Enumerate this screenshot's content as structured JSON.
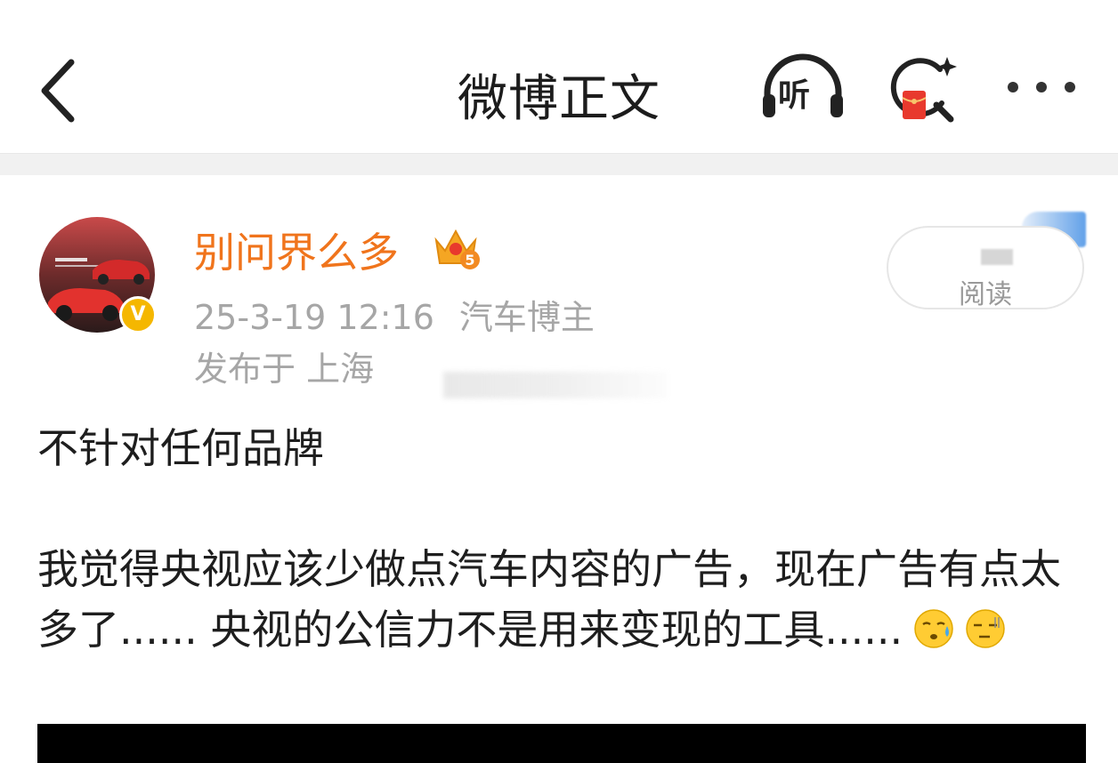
{
  "nav": {
    "back_icon": "chevron-left-icon",
    "title": "微博正文",
    "listen_label": "听",
    "listen_icon": "headphones-icon",
    "redpacket_icon": "red-packet-search-icon",
    "more_icon": "more-dots-icon"
  },
  "post": {
    "author": {
      "name": "别问界么多",
      "avatar_icon": "avatar-car-image",
      "verified_icon": "verified-v-badge",
      "verified_text": "V",
      "level_icon": "crown-level-5-icon"
    },
    "time": "25-3-19 12:16",
    "category": "汽车博主",
    "location": "发布于 上海",
    "read_label": "阅读",
    "paragraphs": [
      "不针对任何品牌",
      "我觉得央视应该少做点汽车内容的广告，现在广告有点太多了...... 央视的公信力不是用来变现的工具......"
    ],
    "emojis": [
      "sweat-emoji",
      "speechless-emoji"
    ]
  },
  "colors": {
    "username": "#f0741c",
    "meta": "#a6a6a6",
    "badge": "#f5b700",
    "background": "#ffffff"
  }
}
